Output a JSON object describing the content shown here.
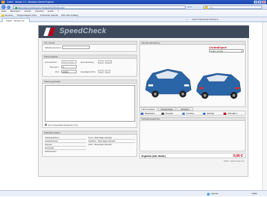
{
  "window": {
    "title": "Zurich - Version 2.0 - Windows Internet Explorer"
  },
  "nav": {
    "address": "https://www.zurichexpert.ch/speedcheck/main.aspx",
    "search_placeholder": "Bing"
  },
  "menu": [
    "Datei",
    "Bearbeiten",
    "Ansicht",
    "Favoriten",
    "Extras",
    "?"
  ],
  "favorites": {
    "label": "Favoriten",
    "items": [
      "Vorgeschlagene Sites",
      "Kostenlose Hotmail",
      "Web Slice-Katalog"
    ]
  },
  "tab": {
    "label": "Zurich - Version 2.0",
    "toolbar_text": "Seite ▾  Sicherheit ▾  Extras ▾"
  },
  "app": {
    "brand": "SpeedCheck",
    "sections": {
      "kunde": {
        "title": "VN / Kunde",
        "schadennummer_label": "Schadennummer:"
      },
      "fahrzeug": {
        "title": "Fahrzeugdaten",
        "kennzeichen_label": "Kennzeichen:",
        "kennzeichen_value": "ZH 12 3456",
        "baujahr_label": "Erstzulassung:",
        "baujahr_placeholders": [
          "01",
          "2010"
        ],
        "kilometer_label": "Kilometer:",
        "kilometer_value": "0",
        "plz_label": "PLZ:",
        "plz_value": "00000",
        "modell_label": "Modelljahr(VIN):",
        "modell_placeholders": [
          "NA",
          "NA"
        ]
      },
      "schaden": {
        "title": "Fahrzeugschaden",
        "checkbox_label": "Nur verwendbar Reparatur (Tm)"
      },
      "kalk": {
        "title": "Kalkulationsdaten",
        "left_rows": [
          "Arbeitsgebühren",
          "Lackfarbkosten",
          "Karosse",
          "Ersatzteile",
          "Nebenkosten"
        ],
        "right_rows": [
          "Front - Mieterlagen (Ersatz)",
          "Seitlicher - Mieterlagen (Ersatz)",
          "Heck - Mieterlagen (Ersatz)"
        ]
      },
      "fahrzeugbild": {
        "title": "Schadendarstellung",
        "vehicle_select": "Cabrio 2-türig",
        "brand_logo": "ContraExpert"
      },
      "tabs": [
        "Fahrzeugdaten",
        "Schadenlayer",
        "Schadtyp"
      ],
      "actions": [
        "Bearbeiten",
        "Drucken",
        "Löschen",
        "Einfüge",
        "Abmelden"
      ],
      "zusatz": {
        "title": "Schadenzusatzinfos"
      },
      "result": {
        "label": "Ergebnis (inkl. MwSt.)",
        "value": "0,00 €"
      },
      "footer": "©2007 · ECIS Version 2.0"
    }
  },
  "status": {
    "zone": "Internet",
    "zoom": "100%"
  },
  "colors": {
    "brand_bar": "#3e4a5c",
    "accent_red": "#c0001a",
    "car_blue": "#2a65a8"
  }
}
